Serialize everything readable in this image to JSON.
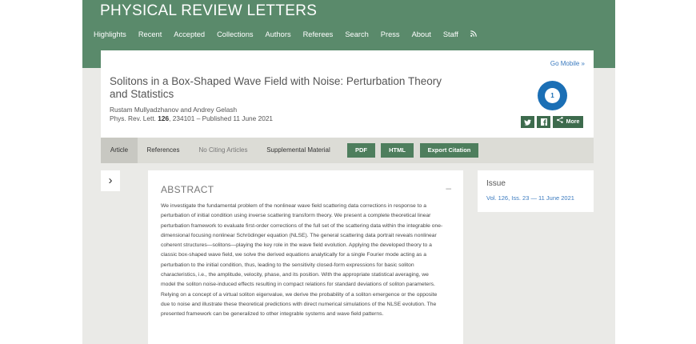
{
  "journal": {
    "title": "PHYSICAL REVIEW LETTERS"
  },
  "nav": {
    "items": [
      {
        "label": "Highlights"
      },
      {
        "label": "Recent"
      },
      {
        "label": "Accepted"
      },
      {
        "label": "Collections"
      },
      {
        "label": "Authors"
      },
      {
        "label": "Referees"
      },
      {
        "label": "Search"
      },
      {
        "label": "Press"
      },
      {
        "label": "About"
      },
      {
        "label": "Staff"
      }
    ],
    "rss_icon": "rss-icon"
  },
  "article": {
    "go_mobile": "Go Mobile »",
    "title": "Solitons in a Box-Shaped Wave Field with Noise: Perturbation Theory and Statistics",
    "authors": "Rustam Mullyadzhanov and Andrey Gelash",
    "citation_prefix": "Phys. Rev. Lett. ",
    "volume": "126",
    "citation_suffix": ", 234101 – Published 11 June 2021",
    "altmetric_score": "1",
    "share": {
      "twitter_icon": "twitter-icon",
      "facebook_icon": "facebook-icon",
      "share_icon": "share-icon",
      "more_label": "More"
    }
  },
  "tabs": {
    "article": "Article",
    "references": "References",
    "citing": "No Citing Articles",
    "supplemental": "Supplemental Material",
    "pdf": "PDF",
    "html": "HTML",
    "export": "Export Citation"
  },
  "abstract": {
    "heading": "ABSTRACT",
    "collapse": "–",
    "text": "We investigate the fundamental problem of the nonlinear wave field scattering data corrections in response to a perturbation of initial condition using inverse scattering transform theory. We present a complete theoretical linear perturbation framework to evaluate first-order corrections of the full set of the scattering data within the integrable one-dimensional focusing nonlinear Schrödinger equation (NLSE). The general scattering data portrait reveals nonlinear coherent structures—solitons—playing the key role in the wave field evolution. Applying the developed theory to a classic box-shaped wave field, we solve the derived equations analytically for a single Fourier mode acting as a perturbation to the initial condition, thus, leading to the sensitivity closed-form expressions for basic soliton characteristics, i.e., the amplitude, velocity, phase, and its position. With the appropriate statistical averaging, we model the soliton noise-induced effects resulting in compact relations for standard deviations of soliton parameters. Relying on a concept of a virtual soliton eigenvalue, we derive the probability of a soliton emergence or the opposite due to noise and illustrate these theoretical predictions with direct numerical simulations of the NLSE evolution. The presented framework can be generalized to other integrable systems and wave field patterns."
  },
  "issue": {
    "heading": "Issue",
    "link": "Vol. 126, Iss. 23 — 11 June 2021"
  },
  "colors": {
    "header_green": "#5a8a6b",
    "button_green": "#4e7e5d",
    "link_blue": "#3a7abf",
    "altmetric_blue": "#1b6fb5"
  }
}
